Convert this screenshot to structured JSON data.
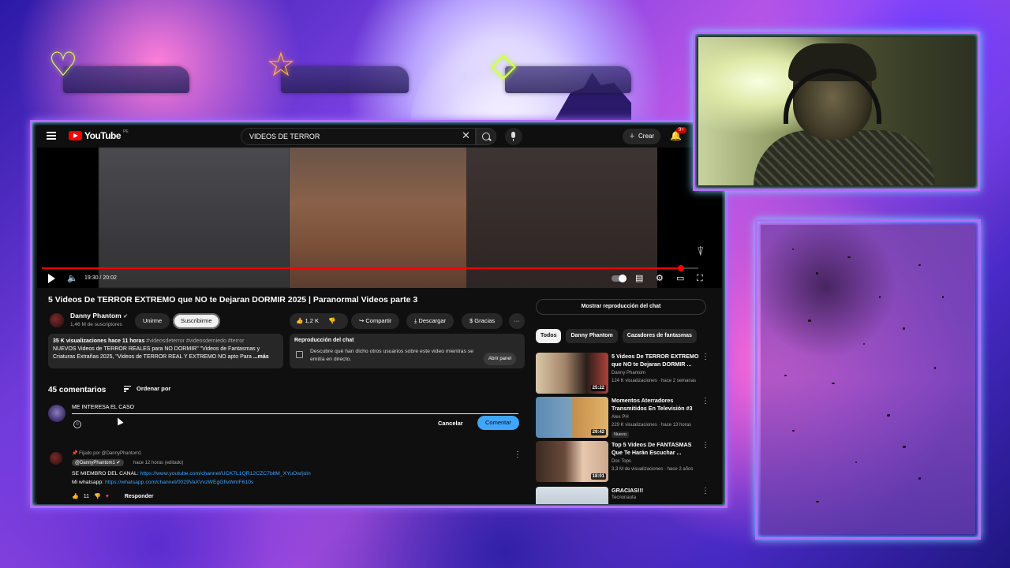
{
  "overlay": {
    "icons": [
      "heart-icon",
      "star-icon",
      "diamond-icon"
    ],
    "accent_color": "#b46cff",
    "glow_color": "#7ad7ff"
  },
  "youtube": {
    "header": {
      "logo_text": "YouTube",
      "logo_country": "PE",
      "search_value": "VIDEOS DE TERROR",
      "create_label": "Crear",
      "notifications_badge": "9+"
    },
    "player": {
      "time": "19:30 / 20:02",
      "progress": 0.974
    },
    "video": {
      "title": "5 Videos De TERROR EXTREMO que NO te Dejaran DORMIR 2025 | Paranormal Videos parte 3",
      "channel": "Danny Phantom",
      "subscribers": "1,46 M de suscriptores",
      "join_label": "Unirme",
      "subscribe_label": "Suscribirme",
      "likes": "1,2 K",
      "share_label": "Compartir",
      "download_label": "Descargar",
      "thanks_label": "Gracias"
    },
    "description": {
      "views_time": "35 K visualizaciones  hace 11 horas",
      "tags": "#videosdeterror #videosdemiedo #terror",
      "line1": "NUEVOS Videos de TERROR REALES para NO DORMIR\" \"Videos de Fantasmas y",
      "line2": "Criaturas Extrañas 2025, \"Videos de TERROR REAL Y EXTREMO NO apto Para",
      "more": "...más"
    },
    "chat_replay": {
      "title": "Reproducción del chat",
      "text": "Descubre qué han dicho otros usuarios sobre este video mientras se emitía en directo.",
      "button": "Abrir panel",
      "show_label": "Mostrar reproducción del chat"
    },
    "comments": {
      "count_label": "45 comentarios",
      "sort_label": "Ordenar por",
      "input_value": "ME INTERESA  EL CASO",
      "cancel_label": "Cancelar",
      "submit_label": "Comentar",
      "pinned": {
        "pinned_by": "Fijado por @DannyPhantom1",
        "author": "@DannyPhantom1",
        "meta": "hace 12 horas (editado)",
        "line1_prefix": "SE MIEMBRO DEL CANAL: ",
        "line1_link": "https://www.youtube.com/channel/UCK7L1QR12CZC7bltM_XYuOw/join",
        "line2_prefix": "Mi whatsapp: ",
        "line2_link": "https://whatsapp.com/channel/0029VaXVvzWEgGfivWmF610s",
        "likes": "11",
        "reply_label": "Responder"
      }
    },
    "filters": [
      "Todos",
      "Danny Phantom",
      "Cazadores de fantasmas"
    ],
    "recommendations": [
      {
        "title": "5 Videos De TERROR EXTREMO que NO te Dejaran DORMIR ...",
        "channel": "Danny Phantom",
        "meta": "124 K visualizaciones · hace 2 semanas",
        "duration": "25:22",
        "badge": ""
      },
      {
        "title": "Momentos Aterradores Transmitidos En Televisión #3",
        "channel": "Alex PH",
        "meta": "229 K visualizaciones · hace 13 horas",
        "duration": "29:42",
        "badge": "Nuevo"
      },
      {
        "title": "Top 5 Videos De FANTASMAS Que Te Harán Escuchar ...",
        "channel": "Doc Tops",
        "meta": "3,3 M de visualizaciones · hace 2 años",
        "duration": "18:01",
        "badge": ""
      },
      {
        "title": "GRACIAS!!!",
        "channel": "Tecnonauta",
        "meta": "",
        "duration": "",
        "badge": ""
      }
    ]
  }
}
